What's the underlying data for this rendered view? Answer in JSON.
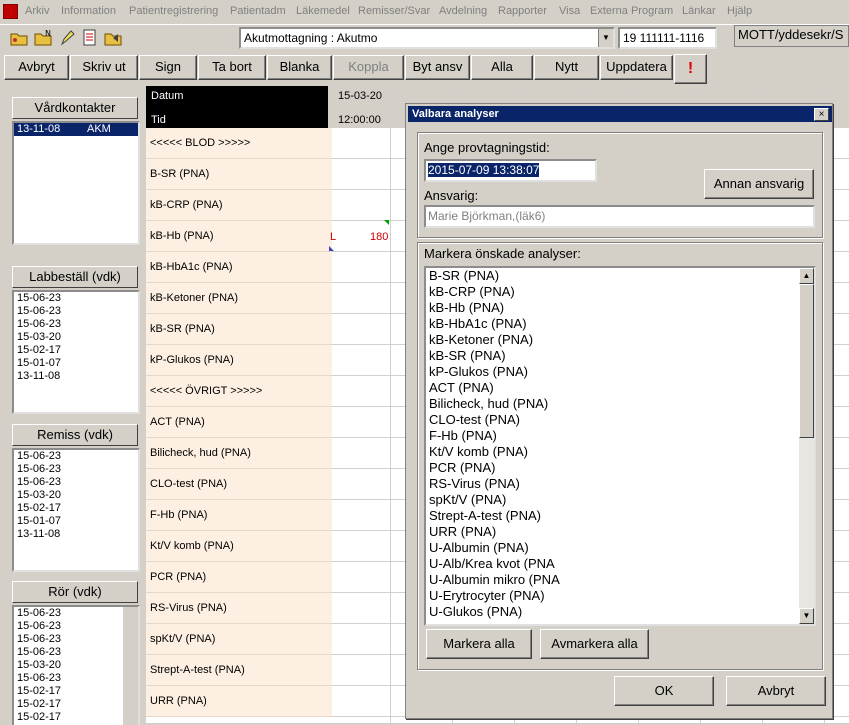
{
  "menubar": {
    "items": [
      "Arkiv",
      "Information",
      "Patientregistrering",
      "Patientadm",
      "Läkemedel",
      "Remisser/Svar",
      "Avdelning",
      "Rapporter",
      "Visa",
      "Externa Program",
      "Länkar",
      "Hjälp"
    ]
  },
  "toolbar": {
    "unit_select": "Akutmottagning : Akutmo",
    "patient_id": "19 111111-1116",
    "user": "MOTT/yddesekr/S"
  },
  "actions": [
    "Avbryt",
    "Skriv ut",
    "Sign",
    "Ta bort",
    "Blanka",
    "Koppla",
    "Byt ansv",
    "Alla",
    "Nytt",
    "Uppdatera"
  ],
  "alert_glyph": "!",
  "left": {
    "vardkontakter_title": "Vårdkontakter",
    "vardkontakter": [
      {
        "date": "13-11-08",
        "unit": "AKM"
      }
    ],
    "labbestall_title": "Labbeställ (vdk)",
    "labbestall": [
      "15-06-23",
      "15-06-23",
      "15-06-23",
      "15-03-20",
      "15-02-17",
      "15-01-07",
      "13-11-08"
    ],
    "remiss_title": "Remiss (vdk)",
    "remiss": [
      "15-06-23",
      "15-06-23",
      "15-06-23",
      "15-03-20",
      "15-02-17",
      "15-01-07",
      "13-11-08"
    ],
    "ror_title": "Rör (vdk)",
    "ror": [
      "15-06-23",
      "15-06-23",
      "15-06-23",
      "15-06-23",
      "15-03-20",
      "15-06-23",
      "15-02-17",
      "15-02-17",
      "15-02-17"
    ]
  },
  "grid": {
    "header_datum": "Datum",
    "header_tid": "Tid",
    "col_date": "15-03-20",
    "col_time": "12:00:00",
    "rows": [
      "<<<<< BLOD >>>>>",
      "B-SR (PNA)",
      "kB-CRP (PNA)",
      "kB-Hb (PNA)",
      "kB-HbA1c (PNA)",
      "kB-Ketoner (PNA)",
      "kB-SR (PNA)",
      "kP-Glukos (PNA)",
      "<<<<< ÖVRIGT >>>>>",
      "ACT (PNA)",
      "Bilicheck, hud (PNA)",
      "CLO-test (PNA)",
      "F-Hb (PNA)",
      "Kt/V komb (PNA)",
      "PCR (PNA)",
      "RS-Virus (PNA)",
      "spKt/V (PNA)",
      "Strept-A-test (PNA)",
      "URR (PNA)"
    ],
    "hb_flag": "L",
    "hb_value": "180"
  },
  "dialog": {
    "title": "Valbara analyser",
    "close": "×",
    "time_label": "Ange provtagningstid:",
    "time_value": "2015-07-09 13:38:07",
    "ansvarig_label": "Ansvarig:",
    "ansvarig_value": "Marie Björkman,(läk6)",
    "annan_button": "Annan ansvarig",
    "list_label": "Markera önskade analyser:",
    "analyses": [
      "B-SR (PNA)",
      "kB-CRP (PNA)",
      "kB-Hb (PNA)",
      "kB-HbA1c (PNA)",
      "kB-Ketoner (PNA)",
      "kB-SR (PNA)",
      "kP-Glukos (PNA)",
      "ACT (PNA)",
      "Bilicheck, hud (PNA)",
      "CLO-test (PNA)",
      "F-Hb (PNA)",
      "Kt/V komb (PNA)",
      "PCR (PNA)",
      "RS-Virus (PNA)",
      "spKt/V (PNA)",
      "Strept-A-test (PNA)",
      "URR (PNA)",
      "U-Albumin (PNA)",
      "U-Alb/Krea kvot (PNA",
      "U-Albumin mikro (PNA",
      "U-Erytrocyter (PNA)",
      "U-Glukos (PNA)"
    ],
    "select_all": "Markera alla",
    "deselect_all": "Avmarkera alla",
    "ok": "OK",
    "cancel": "Avbryt"
  }
}
